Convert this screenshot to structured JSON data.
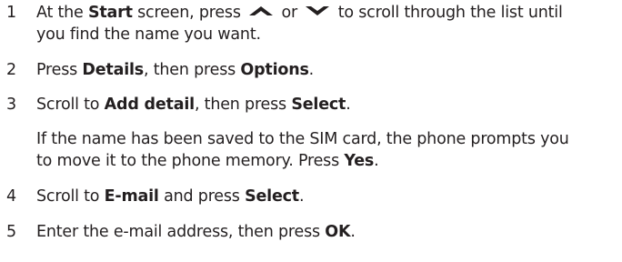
{
  "steps": [
    {
      "number": "1",
      "line1_a": "At the ",
      "line1_b": "Start",
      "line1_c": " screen, press ",
      "line1_or": " or ",
      "line1_d": " to scroll through the list until",
      "up_icon": "scroll-up-key-icon",
      "down_icon": "scroll-down-key-icon",
      "line2": "you find the name you want."
    },
    {
      "number": "2",
      "a": "Press ",
      "b": "Details",
      "c": ", then press ",
      "d": "Options",
      "e": "."
    },
    {
      "number": "3",
      "a": "Scroll to ",
      "b": "Add detail",
      "c": ", then press ",
      "d": "Select",
      "e": ".",
      "note_line1": "If the name has been saved to the SIM card, the phone prompts you",
      "note_line2_a": "to move it to the phone memory. Press ",
      "note_line2_b": "Yes",
      "note_line2_c": "."
    },
    {
      "number": "4",
      "a": "Scroll to ",
      "b": "E-mail",
      "c": " and press ",
      "d": "Select",
      "e": "."
    },
    {
      "number": "5",
      "a": "Enter the e-mail address, then press ",
      "b": "OK",
      "c": "."
    }
  ]
}
